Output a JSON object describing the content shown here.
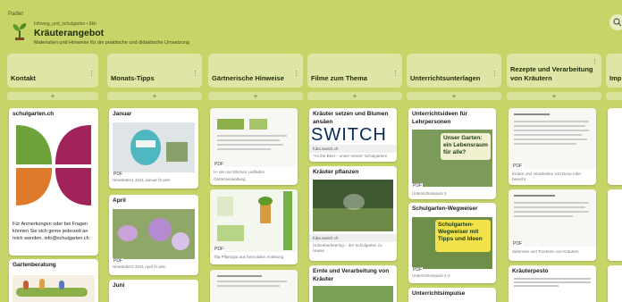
{
  "app": {
    "name": "Padlet"
  },
  "header": {
    "breadcrumb": "Infoweg_und_schulgarten • 8kh",
    "title": "Kräuterangebot",
    "subtitle": "Materialien und Hinweise für die praktische und didaktische Umsetzung"
  },
  "columns": [
    {
      "title": "Kontakt"
    },
    {
      "title": "Monats-Tipps"
    },
    {
      "title": "Gärtnerische Hinweise"
    },
    {
      "title": "Filme zum Thema"
    },
    {
      "title": "Unterrichtsunterlagen"
    },
    {
      "title": "Rezepte und Verarbeitung von Kräutern"
    },
    {
      "title": "Imp"
    }
  ],
  "add_label": "+",
  "menu_glyph": "⋮",
  "pdf_label": "PDF",
  "cards": {
    "kontakt_title": "schulgarten.ch",
    "kontakt_text": "Für Anmerkungen oder bei Fragen können Sie sich gerne jederzeit an mich wenden. info@schulgarten.ch",
    "gartenberatung_title": "Gartenberatung",
    "januar_title": "Januar",
    "januar_caption": "Newsletter1 2021 Januar fit ulen",
    "april_title": "April",
    "april_caption": "Newsletter2 2021 April fit ulen",
    "juni_title": "Juni",
    "gh1_caption1": "H- ule und Blumen Leitfaden",
    "gh1_caption2": "Gartenverwaltung",
    "gh2_caption": "Tita Pflanzgut aus henrotiden Anleitung",
    "film1_title": "Kräuter setzen und Blumen ansäen",
    "film1_link": "fuba.switch.ch",
    "film1_caption": "\"As the Beet – unser Verein\" Schulgarten!",
    "film1_logo": "SWITCH",
    "film2_title": "Kräuter pflanzen",
    "film2_link": "fuba.switch.ch",
    "film2_caption": "Hohenberbeering – der Schulgarten zu Hause",
    "film3_title": "Ernte und Verarbeitung von Kräuter",
    "u1_title": "Unterrichtsideen für Lehrpersonen",
    "u1_overlay": "Unser Garten: ein Lebensraum für alle?",
    "u1_caption": "Unterrichtsimpuls 3",
    "u2_title": "Schulgarten-Wegweiser",
    "u2_overlay": "Schulgarten-Wegweiser mit Tipps und Ideen",
    "u2_caption": "Unterrichtsimpuls 4-3",
    "u3_title": "Unterrichtsimpulse",
    "r1_caption": "Ernten und Verarbeiten von Desa robe berecht",
    "r2_caption": "Sammeln und Trocknen von Kräutern",
    "r3_title": "Kräuterpesto"
  },
  "colors": {
    "background": "#c6d468",
    "column_header": "#dfe6a5",
    "logo_green": "#6da33a",
    "logo_orange": "#de7a2b",
    "logo_purple": "#a2235a"
  }
}
